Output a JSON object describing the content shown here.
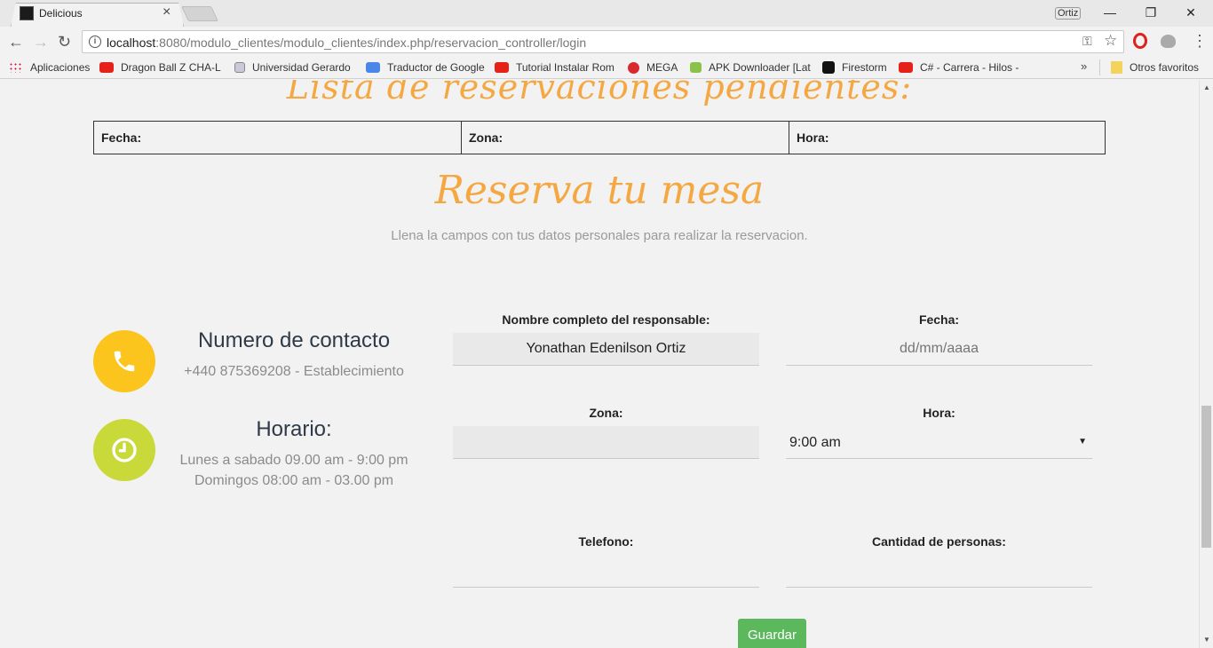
{
  "browser": {
    "tab_title": "Delicious",
    "profile_name": "Ortiz",
    "url_host": "localhost",
    "url_rest": ":8080/modulo_clientes/modulo_clientes/index.php/reservacion_controller/login",
    "bookmarks": [
      {
        "label": "Aplicaciones",
        "icon": "apps-icon"
      },
      {
        "label": "Dragon Ball Z CHA-L",
        "icon": "youtube-icon"
      },
      {
        "label": "Universidad Gerardo",
        "icon": "document-icon"
      },
      {
        "label": "Traductor de Google",
        "icon": "google-translate-icon"
      },
      {
        "label": "Tutorial Instalar Rom",
        "icon": "youtube-icon"
      },
      {
        "label": "MEGA",
        "icon": "mega-icon"
      },
      {
        "label": "APK Downloader [Lat",
        "icon": "apk-icon"
      },
      {
        "label": "Firestorm",
        "icon": "firestorm-icon"
      },
      {
        "label": "C# - Carrera - Hilos -",
        "icon": "youtube-icon"
      }
    ],
    "other_bookmarks": "Otros favoritos",
    "more_bookmarks": "»"
  },
  "page": {
    "pending_title": "Lista de reservaciones pendientes:",
    "table_headers": [
      "Fecha:",
      "Zona:",
      "Hora:"
    ],
    "reserve_title": "Reserva tu mesa",
    "subtitle": "Llena la campos con tus datos personales para realizar la reservacion.",
    "contact": {
      "title": "Numero de contacto",
      "text": "+440 875369208 - Establecimiento"
    },
    "schedule": {
      "title": "Horario:",
      "line1": "Lunes a sabado 09.00 am - 9:00 pm",
      "line2": "Domingos 08:00 am - 03.00 pm"
    },
    "form": {
      "name_label": "Nombre completo del responsable:",
      "name_value": "Yonathan Edenilson Ortiz",
      "date_label": "Fecha:",
      "date_placeholder": "dd/mm/aaaa",
      "zone_label": "Zona:",
      "zone_value": "",
      "time_label": "Hora:",
      "time_value": "9:00 am",
      "phone_label": "Telefono:",
      "phone_value": "",
      "people_label": "Cantidad de personas:",
      "people_value": "",
      "save_label": "Guardar"
    }
  },
  "colors": {
    "accent_script": "#f5a742",
    "contact_circle": "#fbc51d",
    "schedule_circle": "#cad93a",
    "save_button": "#5cb85c"
  }
}
